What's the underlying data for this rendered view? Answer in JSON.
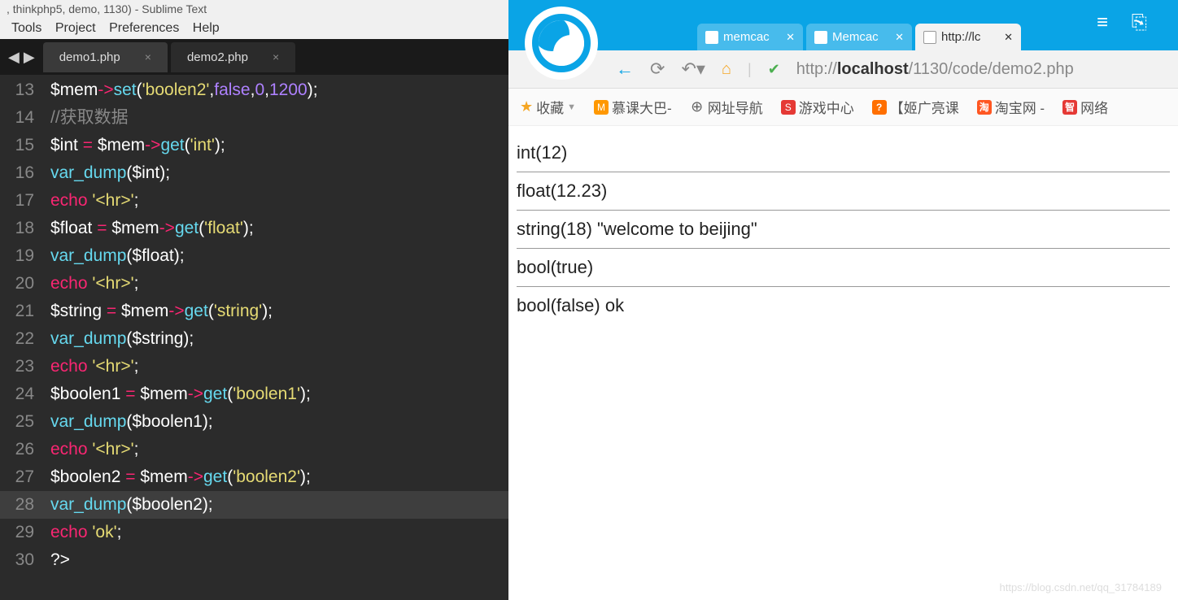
{
  "sublime": {
    "title_suffix": ", thinkphp5, demo, 1130) - Sublime Text",
    "menu": [
      "Tools",
      "Project",
      "Preferences",
      "Help"
    ],
    "tabs": [
      {
        "label": "demo1.php",
        "active": false
      },
      {
        "label": "demo2.php",
        "active": true
      }
    ],
    "line_start": 13,
    "highlighted_line": 28,
    "code_lines": [
      {
        "tokens": [
          [
            "var",
            "$mem"
          ],
          [
            "op",
            "->"
          ],
          [
            "fn",
            "set"
          ],
          [
            "punc",
            "("
          ],
          [
            "str",
            "'boolen2'"
          ],
          [
            "punc",
            ","
          ],
          [
            "num",
            "false"
          ],
          [
            "punc",
            ","
          ],
          [
            "num",
            "0"
          ],
          [
            "punc",
            ","
          ],
          [
            "num",
            "1200"
          ],
          [
            "punc",
            ");"
          ]
        ]
      },
      {
        "tokens": [
          [
            "com",
            "//获取数据"
          ]
        ]
      },
      {
        "tokens": [
          [
            "var",
            "$int"
          ],
          [
            "punc",
            " "
          ],
          [
            "op",
            "="
          ],
          [
            "punc",
            " "
          ],
          [
            "var",
            "$mem"
          ],
          [
            "op",
            "->"
          ],
          [
            "fn",
            "get"
          ],
          [
            "punc",
            "("
          ],
          [
            "str",
            "'int'"
          ],
          [
            "punc",
            ");"
          ]
        ]
      },
      {
        "tokens": [
          [
            "fn",
            "var_dump"
          ],
          [
            "punc",
            "("
          ],
          [
            "var",
            "$int"
          ],
          [
            "punc",
            ");"
          ]
        ]
      },
      {
        "tokens": [
          [
            "kw",
            "echo"
          ],
          [
            "punc",
            " "
          ],
          [
            "str",
            "'<hr>'"
          ],
          [
            "punc",
            ";"
          ]
        ]
      },
      {
        "tokens": [
          [
            "var",
            "$float"
          ],
          [
            "punc",
            " "
          ],
          [
            "op",
            "="
          ],
          [
            "punc",
            " "
          ],
          [
            "var",
            "$mem"
          ],
          [
            "op",
            "->"
          ],
          [
            "fn",
            "get"
          ],
          [
            "punc",
            "("
          ],
          [
            "str",
            "'float'"
          ],
          [
            "punc",
            ");"
          ]
        ]
      },
      {
        "tokens": [
          [
            "fn",
            "var_dump"
          ],
          [
            "punc",
            "("
          ],
          [
            "var",
            "$float"
          ],
          [
            "punc",
            ");"
          ]
        ]
      },
      {
        "tokens": [
          [
            "kw",
            "echo"
          ],
          [
            "punc",
            " "
          ],
          [
            "str",
            "'<hr>'"
          ],
          [
            "punc",
            ";"
          ]
        ]
      },
      {
        "tokens": [
          [
            "var",
            "$string"
          ],
          [
            "punc",
            " "
          ],
          [
            "op",
            "="
          ],
          [
            "punc",
            " "
          ],
          [
            "var",
            "$mem"
          ],
          [
            "op",
            "->"
          ],
          [
            "fn",
            "get"
          ],
          [
            "punc",
            "("
          ],
          [
            "str",
            "'string'"
          ],
          [
            "punc",
            ");"
          ]
        ]
      },
      {
        "tokens": [
          [
            "fn",
            "var_dump"
          ],
          [
            "punc",
            "("
          ],
          [
            "var",
            "$string"
          ],
          [
            "punc",
            ");"
          ]
        ]
      },
      {
        "tokens": [
          [
            "kw",
            "echo"
          ],
          [
            "punc",
            " "
          ],
          [
            "str",
            "'<hr>'"
          ],
          [
            "punc",
            ";"
          ]
        ]
      },
      {
        "tokens": [
          [
            "var",
            "$boolen1"
          ],
          [
            "punc",
            " "
          ],
          [
            "op",
            "="
          ],
          [
            "punc",
            " "
          ],
          [
            "var",
            "$mem"
          ],
          [
            "op",
            "->"
          ],
          [
            "fn",
            "get"
          ],
          [
            "punc",
            "("
          ],
          [
            "str",
            "'boolen1'"
          ],
          [
            "punc",
            ");"
          ]
        ]
      },
      {
        "tokens": [
          [
            "fn",
            "var_dump"
          ],
          [
            "punc",
            "("
          ],
          [
            "var",
            "$boolen1"
          ],
          [
            "punc",
            ");"
          ]
        ]
      },
      {
        "tokens": [
          [
            "kw",
            "echo"
          ],
          [
            "punc",
            " "
          ],
          [
            "str",
            "'<hr>'"
          ],
          [
            "punc",
            ";"
          ]
        ]
      },
      {
        "tokens": [
          [
            "var",
            "$boolen2"
          ],
          [
            "punc",
            " "
          ],
          [
            "op",
            "="
          ],
          [
            "punc",
            " "
          ],
          [
            "var",
            "$mem"
          ],
          [
            "op",
            "->"
          ],
          [
            "fn",
            "get"
          ],
          [
            "punc",
            "("
          ],
          [
            "str",
            "'boolen2'"
          ],
          [
            "punc",
            ");"
          ]
        ]
      },
      {
        "tokens": [
          [
            "fn",
            "var_dump"
          ],
          [
            "punc",
            "("
          ],
          [
            "var",
            "$boolen2"
          ],
          [
            "punc",
            ");"
          ]
        ]
      },
      {
        "tokens": [
          [
            "kw",
            "echo"
          ],
          [
            "punc",
            " "
          ],
          [
            "str",
            "'ok'"
          ],
          [
            "punc",
            ";"
          ]
        ]
      },
      {
        "tokens": [
          [
            "punc",
            "?>"
          ]
        ]
      }
    ]
  },
  "browser": {
    "tabs": [
      {
        "label": "memcac",
        "active": false
      },
      {
        "label": "Memcac",
        "active": false
      },
      {
        "label": "http://lc",
        "active": true
      }
    ],
    "address_prefix": "http://",
    "address_host": "localhost",
    "address_path": "/1130/code/demo2.php",
    "bookmarks": {
      "fav_label": "收藏",
      "items": [
        {
          "icon": "orange",
          "glyph": "M",
          "label": "慕课大巴-"
        },
        {
          "icon": "globe",
          "glyph": "⊕",
          "label": "网址导航"
        },
        {
          "icon": "red",
          "glyph": "S",
          "label": "游戏中心"
        },
        {
          "icon": "orange2",
          "glyph": "?",
          "label": "【姬广亮课"
        },
        {
          "icon": "taobao",
          "glyph": "淘",
          "label": "淘宝网 -"
        },
        {
          "icon": "zhi",
          "glyph": "智",
          "label": "网络"
        }
      ]
    },
    "output": [
      "int(12)",
      "float(12.23)",
      "string(18) \"welcome to beijing\"",
      "bool(true)",
      "bool(false) ok"
    ],
    "watermark": "https://blog.csdn.net/qq_31784189"
  }
}
